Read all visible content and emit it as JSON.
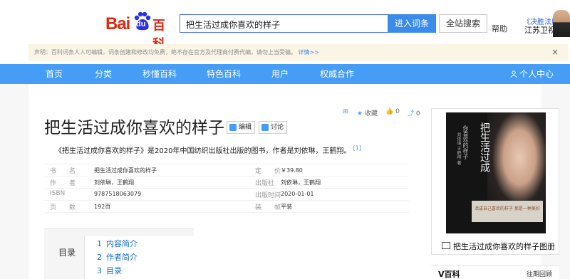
{
  "header": {
    "logo": {
      "bai": "Bai",
      "du": "du",
      "baike": "百科"
    },
    "search_value": "把生活过成你喜欢的样子",
    "enter_button": "进入词条",
    "site_search_button": "全站搜索",
    "help": "帮助",
    "ad_title": "《决胜法庭》",
    "ad_sub": "江苏卫视"
  },
  "notice": {
    "text": "声明：百科词条人人可编辑，词条创建和修改均免费，绝不存在官方及代理商付费代编，请勿上当受骗。",
    "link": "详情>>",
    "close": "×"
  },
  "nav": {
    "items": [
      "首页",
      "分类",
      "秒懂百科",
      "特色百科",
      "用户",
      "权威合作"
    ],
    "user_center": "个人中心"
  },
  "article": {
    "title": "把生活过成你喜欢的样子",
    "edit": "编辑",
    "discuss": "讨论",
    "tools": {
      "collect": "收藏",
      "like_count": "0",
      "share_count": "0"
    },
    "summary": "《把生活过成你喜欢的样子》是2020年中国纺织出版社出版的图书，作者是刘依琳，王鹤翔。",
    "summary_ref": "[1]",
    "info": {
      "left": [
        {
          "label": "书　　名",
          "value": "把生活过成你喜欢的样子"
        },
        {
          "label": "作　　者",
          "value": "刘依琳，王鹤翔"
        },
        {
          "label": "ISBN",
          "value": "9787518063079"
        },
        {
          "label": "页　　数",
          "value": "192页"
        }
      ],
      "right": [
        {
          "label": "定　　价",
          "value": "￥39.80"
        },
        {
          "label": "出版社",
          "value": "刘依琳，王鹤翔"
        },
        {
          "label": "出版时间",
          "value": "2020-01-01"
        },
        {
          "label": "装　　帧",
          "value": "平装"
        }
      ]
    },
    "toc": {
      "label": "目录",
      "items": [
        {
          "num": "1",
          "text": "内容简介"
        },
        {
          "num": "2",
          "text": "作者简介"
        },
        {
          "num": "3",
          "text": "目录"
        }
      ]
    }
  },
  "sidebar": {
    "cover": {
      "title": "把生活过成",
      "subtitle": "你喜欢的样子",
      "byline": "刘依琳 王鹤翔 著",
      "pan_text": "活成自己喜欢的样子 那是一种美好"
    },
    "cover_caption": "把生活过成你喜欢的样子图册",
    "vbaike_title": "V百科",
    "vbaike_more": "往期回顾"
  }
}
